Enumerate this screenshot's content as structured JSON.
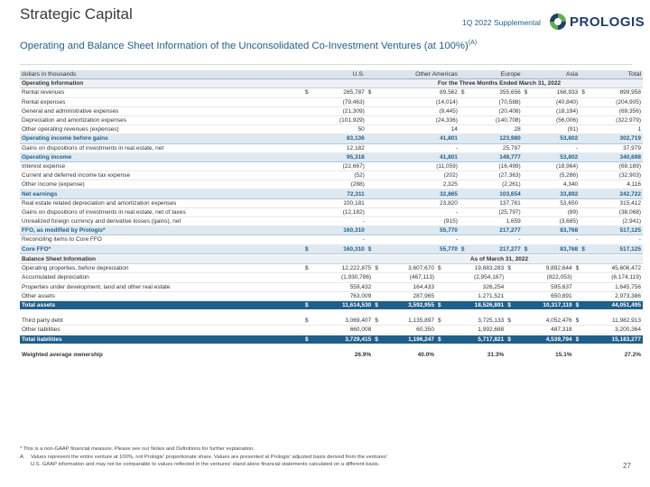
{
  "header": {
    "title": "Strategic Capital",
    "supplemental": "1Q 2022 Supplemental",
    "logo_text": "PROLOGIS",
    "subtitle": "Operating and Balance Sheet Information of the Unconsolidated Co-Investment Ventures (at 100%)",
    "subtitle_sup": "(A)"
  },
  "columns": {
    "units": "dollars in thousands",
    "us": "U.S.",
    "other_americas": "Other Americas",
    "europe": "Europe",
    "asia": "Asia",
    "total": "Total"
  },
  "operating": {
    "section_label": "Operating Information",
    "period_label": "For the Three Months Ended March 31, 2022",
    "rows": [
      {
        "label": "Rental revenues",
        "us": "285,787",
        "oa": "89,562",
        "eu": "355,656",
        "as": "168,933",
        "tot": "899,958",
        "dollar": true,
        "cls": "row"
      },
      {
        "label": "Rental expenses",
        "us": "(79,463)",
        "oa": "(14,014)",
        "eu": "(70,588)",
        "as": "(40,840)",
        "tot": "(204,905)",
        "dollar": false,
        "cls": "row"
      },
      {
        "label": "General and administrative expenses",
        "us": "(21,309)",
        "oa": "(9,445)",
        "eu": "(20,408)",
        "as": "(18,194)",
        "tot": "(69,356)",
        "dollar": false,
        "cls": "row"
      },
      {
        "label": "Depreciation and amortization expenses",
        "us": "(101,929)",
        "oa": "(24,336)",
        "eu": "(140,708)",
        "as": "(56,006)",
        "tot": "(322,979)",
        "dollar": false,
        "cls": "row"
      },
      {
        "label": "Other operating revenues (expenses)",
        "us": "50",
        "oa": "14",
        "eu": "28",
        "as": "(91)",
        "tot": "1",
        "dollar": false,
        "cls": "row"
      },
      {
        "label": "Operating income before gains",
        "us": "83,136",
        "oa": "41,801",
        "eu": "123,980",
        "as": "53,802",
        "tot": "302,719",
        "dollar": false,
        "cls": "hi"
      },
      {
        "label": "Gains on dispositions of investments in real estate, net",
        "us": "12,182",
        "oa": "-",
        "eu": "25,797",
        "as": "-",
        "tot": "37,979",
        "dollar": false,
        "cls": "row"
      },
      {
        "label": "Operating income",
        "us": "95,318",
        "oa": "41,801",
        "eu": "149,777",
        "as": "53,802",
        "tot": "340,698",
        "dollar": false,
        "cls": "hi"
      },
      {
        "label": "Interest expense",
        "us": "(22,667)",
        "oa": "(11,059)",
        "eu": "(16,499)",
        "as": "(18,964)",
        "tot": "(69,189)",
        "dollar": false,
        "cls": "row"
      },
      {
        "label": "Current and deferred income tax expense",
        "us": "(52)",
        "oa": "(202)",
        "eu": "(27,363)",
        "as": "(5,286)",
        "tot": "(32,903)",
        "dollar": false,
        "cls": "row"
      },
      {
        "label": "Other income (expense)",
        "us": "(288)",
        "oa": "2,325",
        "eu": "(2,261)",
        "as": "4,340",
        "tot": "4,116",
        "dollar": false,
        "cls": "row"
      },
      {
        "label": "Net earnings",
        "us": "72,311",
        "oa": "32,865",
        "eu": "103,654",
        "as": "33,892",
        "tot": "242,722",
        "dollar": false,
        "cls": "hi"
      },
      {
        "label": "Real estate related depreciation and amortization expenses",
        "us": "100,181",
        "oa": "23,820",
        "eu": "137,761",
        "as": "53,650",
        "tot": "315,412",
        "dollar": false,
        "cls": "row"
      },
      {
        "label": "Gains on dispositions of investments in real estate, net of taxes",
        "us": "(12,182)",
        "oa": "-",
        "eu": "(25,797)",
        "as": "(89)",
        "tot": "(38,068)",
        "dollar": false,
        "cls": "row"
      },
      {
        "label": "Unrealized foreign currency and derivative losses (gains), net",
        "us": "-",
        "oa": "(915)",
        "eu": "1,659",
        "as": "(3,685)",
        "tot": "(2,941)",
        "dollar": false,
        "cls": "row"
      },
      {
        "label": "FFO, as modified by Prologis*",
        "us": "160,310",
        "oa": "55,770",
        "eu": "217,277",
        "as": "83,768",
        "tot": "517,125",
        "dollar": false,
        "cls": "hi"
      },
      {
        "label": "Reconciling items to Core FFO",
        "us": "-",
        "oa": "-",
        "eu": "-",
        "as": "-",
        "tot": "-",
        "dollar": false,
        "cls": "row"
      },
      {
        "label": "Core FFO*",
        "us": "160,310",
        "oa": "55,770",
        "eu": "217,277",
        "as": "83,768",
        "tot": "517,125",
        "dollar": true,
        "cls": "hi"
      }
    ]
  },
  "balance": {
    "section_label": "Balance Sheet Information",
    "period_label": "As of March 31, 2022",
    "rows": [
      {
        "label": "Operating properties, before depreciation",
        "us": "12,222,875",
        "oa": "3,607,670",
        "eu": "19,883,283",
        "as": "9,892,644",
        "tot": "45,606,472",
        "dollar": true,
        "cls": "row"
      },
      {
        "label": "Accumulated depreciation",
        "us": "(1,930,786)",
        "oa": "(467,113)",
        "eu": "(2,954,167)",
        "as": "(822,053)",
        "tot": "(6,174,119)",
        "dollar": false,
        "cls": "row"
      },
      {
        "label": "Properties under development, land and other real estate",
        "us": "559,432",
        "oa": "164,433",
        "eu": "326,254",
        "as": "595,637",
        "tot": "1,645,756",
        "dollar": false,
        "cls": "row"
      },
      {
        "label": "Other assets",
        "us": "763,009",
        "oa": "287,965",
        "eu": "1,271,521",
        "as": "650,891",
        "tot": "2,973,386",
        "dollar": false,
        "cls": "row"
      },
      {
        "label": "Total assets",
        "us": "11,614,530",
        "oa": "3,592,955",
        "eu": "18,526,891",
        "as": "10,317,119",
        "tot": "44,051,495",
        "dollar": true,
        "cls": "total"
      },
      {
        "label": "",
        "us": "",
        "oa": "",
        "eu": "",
        "as": "",
        "tot": "",
        "dollar": false,
        "cls": "spacer"
      },
      {
        "label": "Third party debt",
        "us": "3,069,407",
        "oa": "1,135,897",
        "eu": "3,725,133",
        "as": "4,052,476",
        "tot": "11,982,913",
        "dollar": true,
        "cls": "row"
      },
      {
        "label": "Other liabilities",
        "us": "660,008",
        "oa": "60,350",
        "eu": "1,992,688",
        "as": "487,318",
        "tot": "3,200,364",
        "dollar": false,
        "cls": "row"
      },
      {
        "label": "Total liabilities",
        "us": "3,729,415",
        "oa": "1,196,247",
        "eu": "5,717,821",
        "as": "4,539,794",
        "tot": "15,183,277",
        "dollar": true,
        "cls": "total"
      },
      {
        "label": "",
        "us": "",
        "oa": "",
        "eu": "",
        "as": "",
        "tot": "",
        "dollar": false,
        "cls": "spacer"
      },
      {
        "label": "Weighted average ownership",
        "us": "26.9%",
        "oa": "40.0%",
        "eu": "31.3%",
        "as": "15.1%",
        "tot": "27.2%",
        "dollar": false,
        "cls": "wavg"
      }
    ]
  },
  "footnotes": {
    "star": "* This is a non-GAAP financial measure. Please see our Notes and Definitions for further explanation.",
    "a_marker": "A.",
    "a_line1": "Values represent the entire venture at 100%, not Prologis' proportionate share. Values are presented at Prologis' adjusted basis derived from the ventures'",
    "a_line2": "U.S. GAAP information and may not be comparable to values reflected in the ventures' stand alone financial statements calculated on a different basis."
  },
  "page_number": "27",
  "colors": {
    "brand_blue": "#1f5f8b",
    "logo_green": "#5bb14c"
  }
}
